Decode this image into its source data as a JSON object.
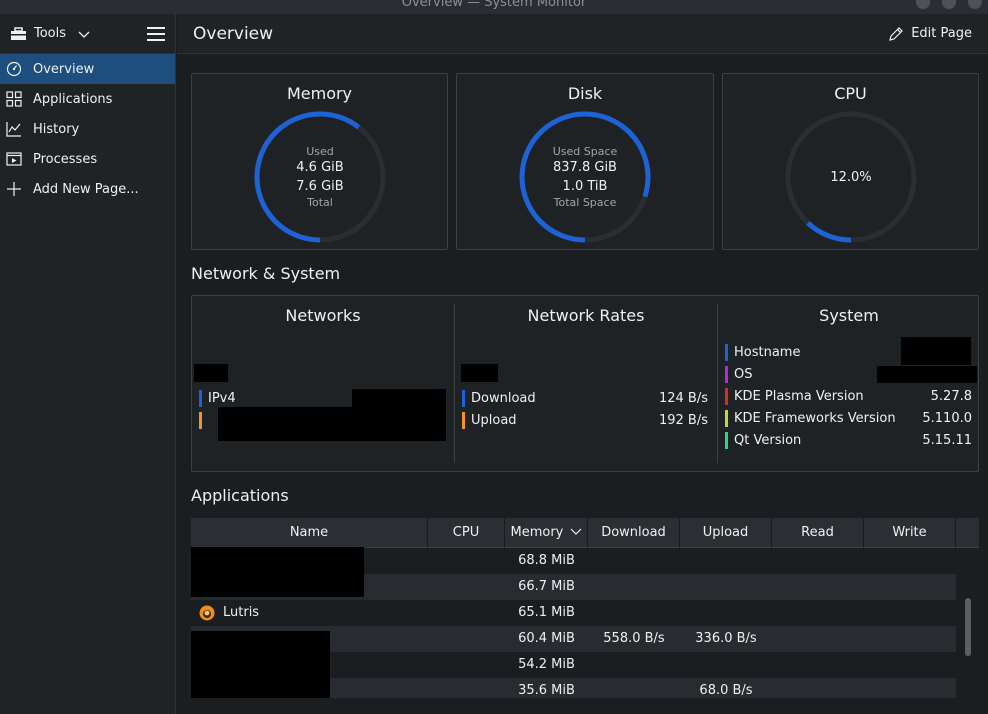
{
  "window": {
    "title": "Overview — System Monitor"
  },
  "sidebar": {
    "tools_label": "Tools",
    "items": [
      {
        "label": "Overview",
        "icon": "overview-icon",
        "active": true
      },
      {
        "label": "Applications",
        "icon": "applications-icon"
      },
      {
        "label": "History",
        "icon": "history-icon"
      },
      {
        "label": "Processes",
        "icon": "processes-icon"
      },
      {
        "label": "Add New Page...",
        "icon": "plus-icon"
      }
    ]
  },
  "header": {
    "title": "Overview",
    "edit_label": "Edit Page"
  },
  "cards": {
    "memory": {
      "title": "Memory",
      "used_label": "Used",
      "used": "4.6 GiB",
      "total": "7.6 GiB",
      "total_label": "Total",
      "fraction": 0.605
    },
    "disk": {
      "title": "Disk",
      "used_label": "Used Space",
      "used": "837.8 GiB",
      "total": "1.0 TiB",
      "total_label": "Total Space",
      "fraction": 0.8
    },
    "cpu": {
      "title": "CPU",
      "value": "12.0%",
      "fraction": 0.12
    }
  },
  "accent_color": "#1d63d6",
  "network_section": {
    "title": "Network & System",
    "networks": {
      "title": "Networks",
      "rows": [
        {
          "label": "IPv4",
          "color": "#1d63d6"
        },
        {
          "label": "",
          "color": "#f0932b"
        }
      ]
    },
    "rates": {
      "title": "Network Rates",
      "rows": [
        {
          "label": "Download",
          "value": "124 B/s",
          "color": "#1d63d6"
        },
        {
          "label": "Upload",
          "value": "192 B/s",
          "color": "#f0932b"
        }
      ]
    },
    "system": {
      "title": "System",
      "rows": [
        {
          "label": "Hostname",
          "value": "",
          "color": "#1d63d6"
        },
        {
          "label": "OS",
          "value": "",
          "color": "#b02cd6"
        },
        {
          "label": "KDE Plasma Version",
          "value": "5.27.8",
          "color": "#d62c2c"
        },
        {
          "label": "KDE Frameworks Version",
          "value": "5.110.0",
          "color": "#c8d62c"
        },
        {
          "label": "Qt Version",
          "value": "5.15.11",
          "color": "#2cd67a"
        }
      ]
    }
  },
  "applications": {
    "title": "Applications",
    "columns": [
      "Name",
      "CPU",
      "Memory",
      "Download",
      "Upload",
      "Read",
      "Write"
    ],
    "sorted_column": "Memory",
    "rows": [
      {
        "name": "",
        "cpu": "",
        "memory": "68.8 MiB",
        "download": "",
        "upload": "",
        "read": "",
        "write": ""
      },
      {
        "name": "",
        "cpu": "",
        "memory": "66.7 MiB",
        "download": "",
        "upload": "",
        "read": "",
        "write": ""
      },
      {
        "name": "Lutris",
        "icon": "lutris-icon",
        "cpu": "",
        "memory": "65.1 MiB",
        "download": "",
        "upload": "",
        "read": "",
        "write": ""
      },
      {
        "name": "",
        "cpu": "",
        "memory": "60.4 MiB",
        "download": "558.0 B/s",
        "upload": "336.0 B/s",
        "read": "",
        "write": ""
      },
      {
        "name": "",
        "cpu": "",
        "memory": "54.2 MiB",
        "download": "",
        "upload": "",
        "read": "",
        "write": ""
      },
      {
        "name": "",
        "cpu": "",
        "memory": "35.6 MiB",
        "download": "",
        "upload": "68.0 B/s",
        "read": "",
        "write": ""
      }
    ]
  }
}
